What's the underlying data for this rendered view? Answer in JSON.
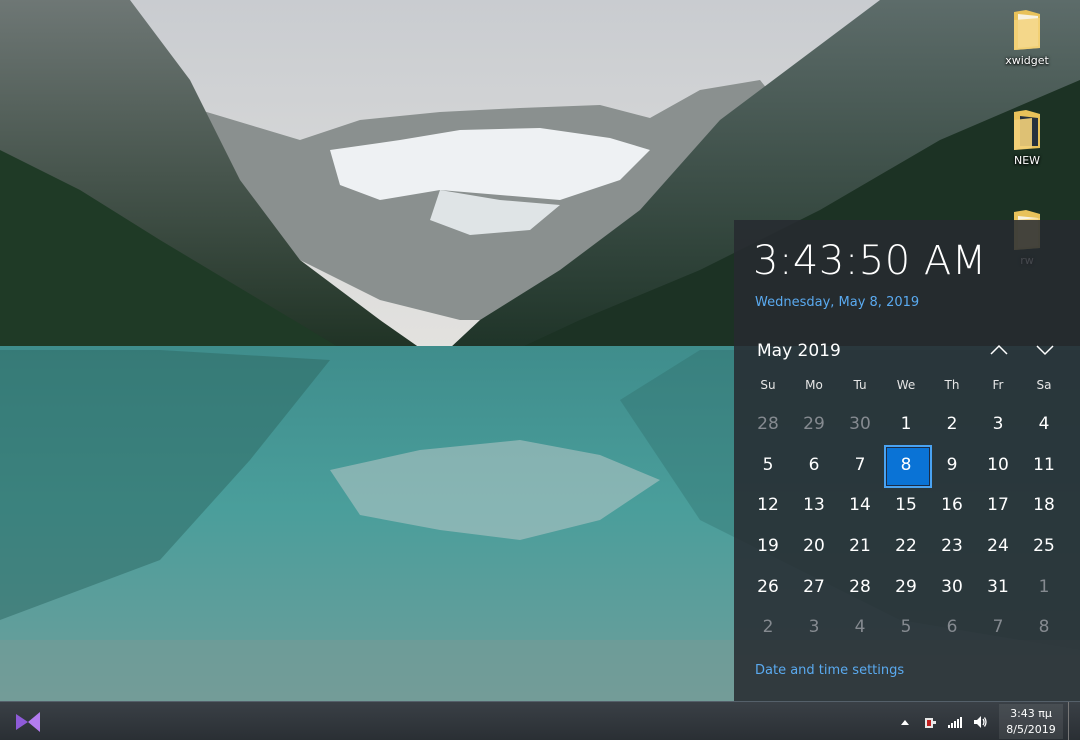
{
  "desktop": {
    "icons": [
      {
        "label": "xwidget",
        "icon": "folder-icon"
      },
      {
        "label": "NEW",
        "icon": "folder-icon"
      },
      {
        "label": "rw",
        "icon": "folder-icon"
      }
    ]
  },
  "flyout": {
    "time": "3:43:50 AM",
    "date": "Wednesday, May 8, 2019",
    "month_label": "May 2019",
    "prev_icon": "chevron-up-icon",
    "next_icon": "chevron-down-icon",
    "weekdays": [
      "Su",
      "Mo",
      "Tu",
      "We",
      "Th",
      "Fr",
      "Sa"
    ],
    "days": [
      {
        "n": "28",
        "muted": true
      },
      {
        "n": "29",
        "muted": true
      },
      {
        "n": "30",
        "muted": true
      },
      {
        "n": "1"
      },
      {
        "n": "2"
      },
      {
        "n": "3"
      },
      {
        "n": "4"
      },
      {
        "n": "5"
      },
      {
        "n": "6"
      },
      {
        "n": "7"
      },
      {
        "n": "8",
        "today": true
      },
      {
        "n": "9"
      },
      {
        "n": "10"
      },
      {
        "n": "11"
      },
      {
        "n": "12"
      },
      {
        "n": "13"
      },
      {
        "n": "14"
      },
      {
        "n": "15"
      },
      {
        "n": "16"
      },
      {
        "n": "17"
      },
      {
        "n": "18"
      },
      {
        "n": "19"
      },
      {
        "n": "20"
      },
      {
        "n": "21"
      },
      {
        "n": "22"
      },
      {
        "n": "23"
      },
      {
        "n": "24"
      },
      {
        "n": "25"
      },
      {
        "n": "26"
      },
      {
        "n": "27"
      },
      {
        "n": "28"
      },
      {
        "n": "29"
      },
      {
        "n": "30"
      },
      {
        "n": "31"
      },
      {
        "n": "1",
        "muted": true
      },
      {
        "n": "2",
        "muted": true
      },
      {
        "n": "3",
        "muted": true
      },
      {
        "n": "4",
        "muted": true
      },
      {
        "n": "5",
        "muted": true
      },
      {
        "n": "6",
        "muted": true
      },
      {
        "n": "7",
        "muted": true
      },
      {
        "n": "8",
        "muted": true
      }
    ],
    "settings_link": "Date and time settings"
  },
  "taskbar": {
    "app_icon": "visual-studio-icon",
    "tray_icons": [
      "show-hidden-icons-chevron-icon",
      "power-plug-icon",
      "network-signal-icon",
      "speaker-volume-icon"
    ],
    "clock_time": "3:43 πμ",
    "clock_date": "8/5/2019"
  },
  "colors": {
    "accent": "#0a73d6",
    "link": "#5aaaf0",
    "flyout_bg": "#262a30"
  }
}
